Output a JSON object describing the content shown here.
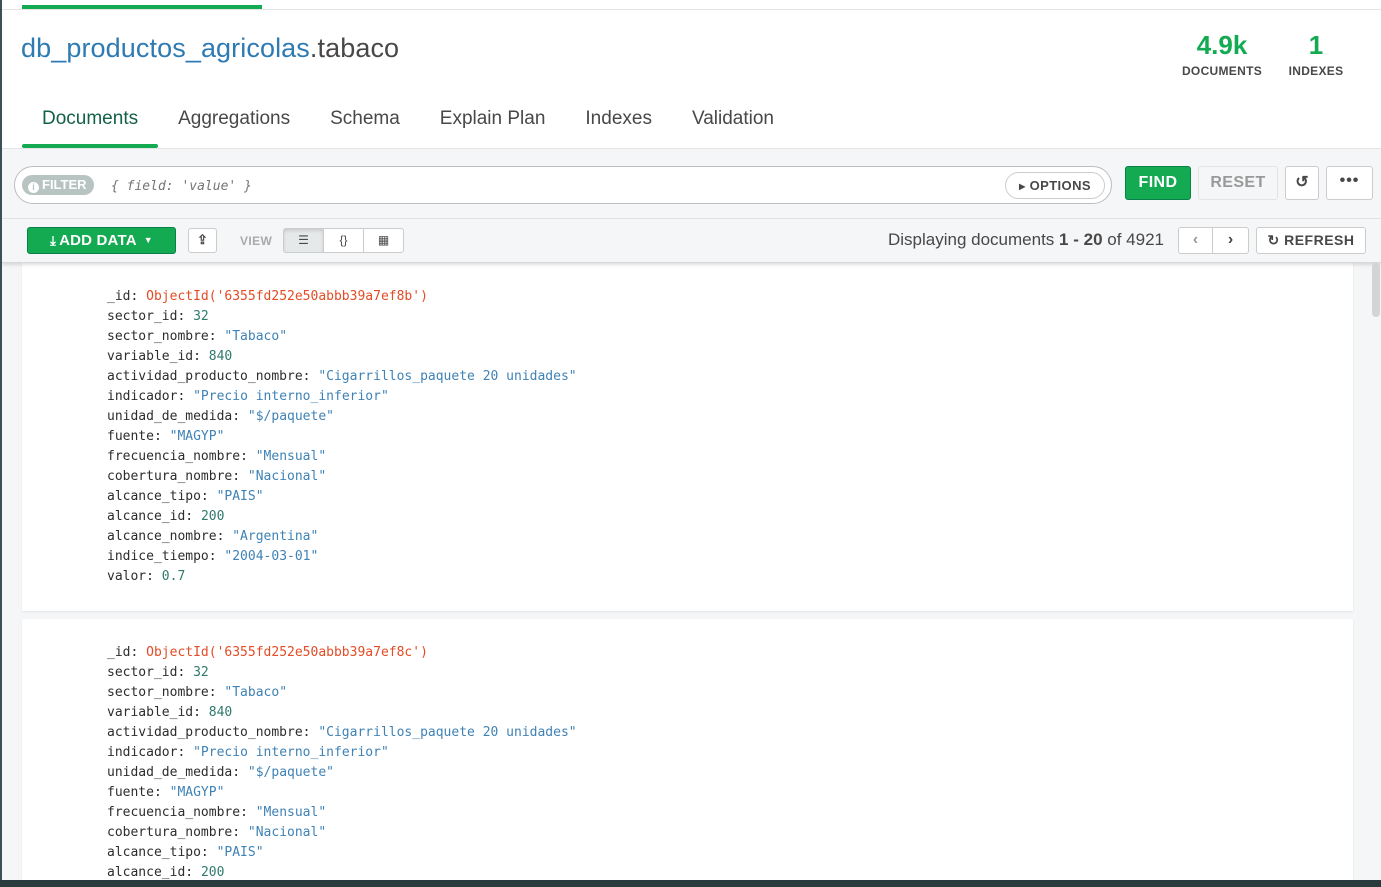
{
  "namespace": {
    "db": "db_productos_agricolas",
    "collection": ".tabaco"
  },
  "stats": {
    "documents_value": "4.9k",
    "documents_label": "DOCUMENTS",
    "indexes_value": "1",
    "indexes_label": "INDEXES"
  },
  "tabs": [
    {
      "label": "Documents",
      "active": true
    },
    {
      "label": "Aggregations"
    },
    {
      "label": "Schema"
    },
    {
      "label": "Explain Plan"
    },
    {
      "label": "Indexes"
    },
    {
      "label": "Validation"
    }
  ],
  "query": {
    "filter_label": "FILTER",
    "filter_placeholder": "{ field: 'value' }",
    "options_label": "OPTIONS",
    "find_label": "FIND",
    "reset_label": "RESET",
    "more_label": "•••"
  },
  "toolbar": {
    "add_data_label": "ADD DATA",
    "view_label": "VIEW",
    "pager": {
      "prefix": "Displaying documents ",
      "start": "1",
      "sep": " - ",
      "end": "20",
      "of": " of ",
      "total": "4921"
    },
    "refresh_label": "REFRESH"
  },
  "documents": [
    {
      "fields": [
        {
          "key": "_id",
          "value": "ObjectId('6355fd252e50abbb39a7ef8b')",
          "type": "oid"
        },
        {
          "key": "sector_id",
          "value": "32",
          "type": "num"
        },
        {
          "key": "sector_nombre",
          "value": "\"Tabaco\"",
          "type": "str"
        },
        {
          "key": "variable_id",
          "value": "840",
          "type": "num"
        },
        {
          "key": "actividad_producto_nombre",
          "value": "\"Cigarrillos_paquete 20 unidades\"",
          "type": "str"
        },
        {
          "key": "indicador",
          "value": "\"Precio interno_inferior\"",
          "type": "str"
        },
        {
          "key": "unidad_de_medida",
          "value": "\"$/paquete\"",
          "type": "str"
        },
        {
          "key": "fuente",
          "value": "\"MAGYP\"",
          "type": "str"
        },
        {
          "key": "frecuencia_nombre",
          "value": "\"Mensual\"",
          "type": "str"
        },
        {
          "key": "cobertura_nombre",
          "value": "\"Nacional\"",
          "type": "str"
        },
        {
          "key": "alcance_tipo",
          "value": "\"PAIS\"",
          "type": "str"
        },
        {
          "key": "alcance_id",
          "value": "200",
          "type": "num"
        },
        {
          "key": "alcance_nombre",
          "value": "\"Argentina\"",
          "type": "str"
        },
        {
          "key": "indice_tiempo",
          "value": "\"2004-03-01\"",
          "type": "str"
        },
        {
          "key": "valor",
          "value": "0.7",
          "type": "num"
        }
      ]
    },
    {
      "fields": [
        {
          "key": "_id",
          "value": "ObjectId('6355fd252e50abbb39a7ef8c')",
          "type": "oid"
        },
        {
          "key": "sector_id",
          "value": "32",
          "type": "num"
        },
        {
          "key": "sector_nombre",
          "value": "\"Tabaco\"",
          "type": "str"
        },
        {
          "key": "variable_id",
          "value": "840",
          "type": "num"
        },
        {
          "key": "actividad_producto_nombre",
          "value": "\"Cigarrillos_paquete 20 unidades\"",
          "type": "str"
        },
        {
          "key": "indicador",
          "value": "\"Precio interno_inferior\"",
          "type": "str"
        },
        {
          "key": "unidad_de_medida",
          "value": "\"$/paquete\"",
          "type": "str"
        },
        {
          "key": "fuente",
          "value": "\"MAGYP\"",
          "type": "str"
        },
        {
          "key": "frecuencia_nombre",
          "value": "\"Mensual\"",
          "type": "str"
        },
        {
          "key": "cobertura_nombre",
          "value": "\"Nacional\"",
          "type": "str"
        },
        {
          "key": "alcance_tipo",
          "value": "\"PAIS\"",
          "type": "str"
        },
        {
          "key": "alcance_id",
          "value": "200",
          "type": "num"
        }
      ]
    }
  ],
  "colors": {
    "brand_green": "#13aa52",
    "namespace_blue": "#2e7ab3",
    "string_value": "#3f82b5",
    "objectid_value": "#e34c26"
  }
}
